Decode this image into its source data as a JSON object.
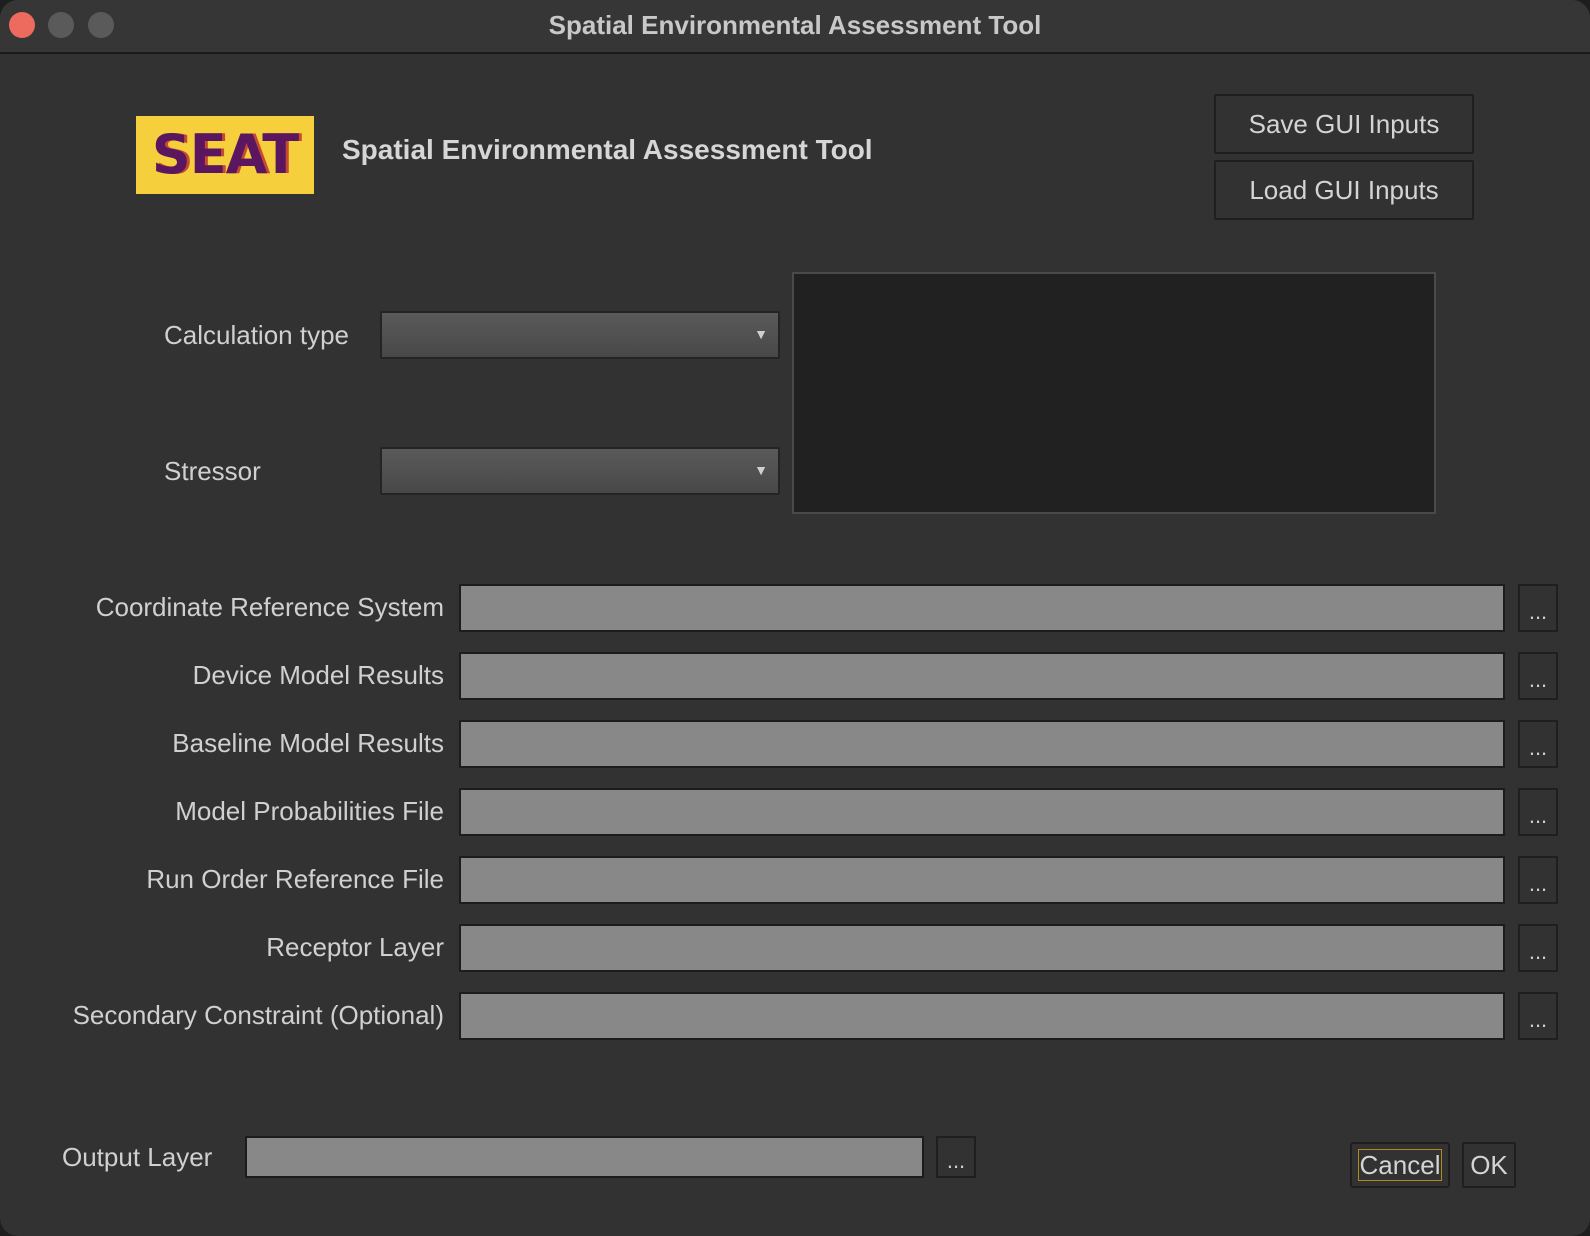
{
  "window": {
    "title": "Spatial Environmental Assessment Tool"
  },
  "header": {
    "logo_text": "SEAT",
    "title": "Spatial Environmental Assessment Tool",
    "save_label": "Save GUI Inputs",
    "load_label": "Load GUI Inputs"
  },
  "selectors": {
    "calculation_type_label": "Calculation type",
    "calculation_type_value": "",
    "stressor_label": "Stressor",
    "stressor_value": ""
  },
  "inputs": [
    {
      "label": "Coordinate Reference System",
      "value": "",
      "browse": "..."
    },
    {
      "label": "Device Model Results",
      "value": "",
      "browse": "..."
    },
    {
      "label": "Baseline Model Results",
      "value": "",
      "browse": "..."
    },
    {
      "label": "Model Probabilities File",
      "value": "",
      "browse": "..."
    },
    {
      "label": "Run Order Reference File",
      "value": "",
      "browse": "..."
    },
    {
      "label": "Receptor Layer",
      "value": "",
      "browse": "..."
    },
    {
      "label": "Secondary Constraint (Optional)",
      "value": "",
      "browse": "..."
    }
  ],
  "output": {
    "label": "Output Layer",
    "value": "",
    "browse": "..."
  },
  "footer": {
    "cancel_label": "Cancel",
    "ok_label": "OK"
  },
  "colors": {
    "window_bg": "#323232",
    "field_bg": "#888888",
    "logo_bg": "#f6cf3c",
    "logo_text": "#5b1660",
    "close_button": "#ed6a5e"
  },
  "icons": {
    "dropdown": "chevron-down-icon",
    "browse": "ellipsis-icon"
  }
}
